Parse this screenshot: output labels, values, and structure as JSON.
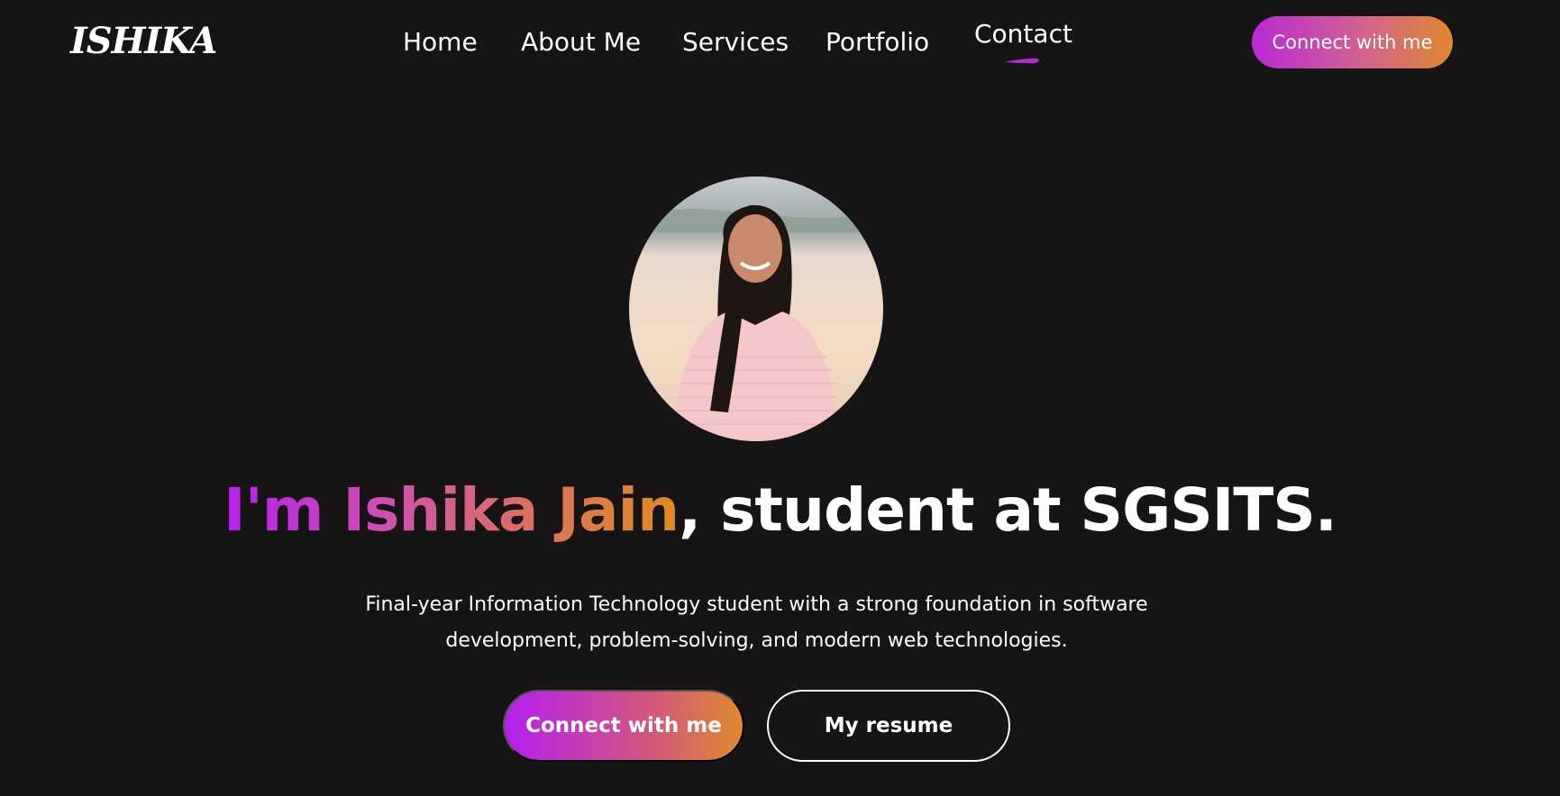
{
  "brand": {
    "logo_text": "ISHIKA"
  },
  "nav": {
    "items": [
      {
        "label": "Home"
      },
      {
        "label": "About Me"
      },
      {
        "label": "Services"
      },
      {
        "label": "Portfolio"
      },
      {
        "label": "Contact",
        "active": true
      }
    ],
    "cta_label": "Connect with me"
  },
  "hero": {
    "headline_name": "I'm Ishika Jain",
    "headline_rest": ", student at SGSITS.",
    "subtitle_line1": "Final-year Information Technology student with a strong foundation in software",
    "subtitle_line2": "development, problem-solving, and modern web technologies.",
    "primary_button": "Connect with me",
    "secondary_button": "My resume"
  },
  "colors": {
    "background": "#161414",
    "gradient_start": "#b51ff0",
    "gradient_mid": "#d0567f",
    "gradient_end": "#e0882f"
  }
}
